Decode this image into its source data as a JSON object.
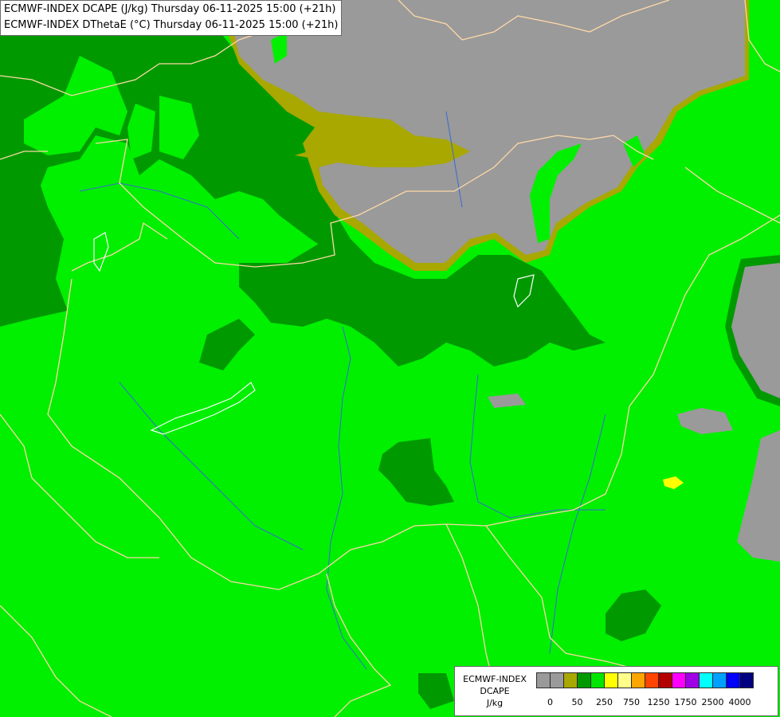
{
  "title": {
    "line1": "ECMWF-INDEX DCAPE (J/kg) Thursday 06-11-2025 15:00 (+21h)",
    "line2": "ECMWF-INDEX DThetaE (°C) Thursday 06-11-2025 15:00 (+21h)"
  },
  "legend": {
    "line1": "ECMWF-INDEX",
    "line2": "DCAPE",
    "line3": "J/kg",
    "tick_labels": [
      "0",
      "50",
      "250",
      "750",
      "1250",
      "1750",
      "2500",
      "4000"
    ],
    "colors": [
      "#9a9a9a",
      "#9a9a9a",
      "#a8a800",
      "#009a00",
      "#00e600",
      "#ffff00",
      "#ffff8a",
      "#ffa500",
      "#ff4500",
      "#b40000",
      "#ff00ff",
      "#a000e6",
      "#00ffff",
      "#00a0ff",
      "#0000ff",
      "#000080"
    ]
  },
  "map_colors": {
    "bright_green": "#00f000",
    "dark_green": "#009a00",
    "olive": "#a8a800",
    "gray": "#9a9a9a",
    "border": "#ffd8a8",
    "river": "#3a6ad0",
    "lake_outline": "#ffffff",
    "yellow": "#ffff00"
  }
}
